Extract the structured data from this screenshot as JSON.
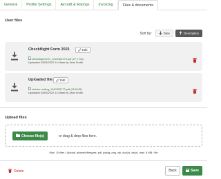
{
  "tabs": [
    {
      "label": "General",
      "active": false
    },
    {
      "label": "Profile Settings",
      "active": false
    },
    {
      "label": "Aircraft & Ratings",
      "active": false
    },
    {
      "label": "Invoicing",
      "active": false
    },
    {
      "label": "Files & documents",
      "active": true
    }
  ],
  "user_files": {
    "title": "User files",
    "sort": {
      "label": "Sort by:",
      "options": [
        {
          "label": "Date",
          "active": false
        },
        {
          "label": "Description",
          "active": true
        }
      ]
    },
    "items": [
      {
        "name": "Checkflight Form 2021",
        "edit_label": "Edit",
        "file_link": "checkflight2021_1040328173.pdf (27.7 KB)",
        "meta": "Uploaded 03/03/2022 11:49am by Jane Smith"
      },
      {
        "name": "Uploaded file",
        "edit_label": "Edit",
        "file_link": "charter-vetting_1040335773.pdf (26.8 KB)",
        "meta": "Uploaded 03/03/2022 11:49am by Jane Smith"
      }
    ]
  },
  "upload": {
    "title": "Upload files",
    "choose_label": "Choose file(s)",
    "drop_text": "or drag & drop files here.",
    "hint": "Max. 10 files / Upload, allowed filetypes: pdf, jp(e)g, png, zip, doc(x), xls(x), max. 8 MB / file"
  },
  "footer": {
    "delete_label": "Delete",
    "back_label": "Back",
    "save_label": "Save"
  },
  "colors": {
    "accent": "#3c8a4a",
    "link": "#2e7d32",
    "danger": "#c62828",
    "dark_button": "#575757"
  }
}
